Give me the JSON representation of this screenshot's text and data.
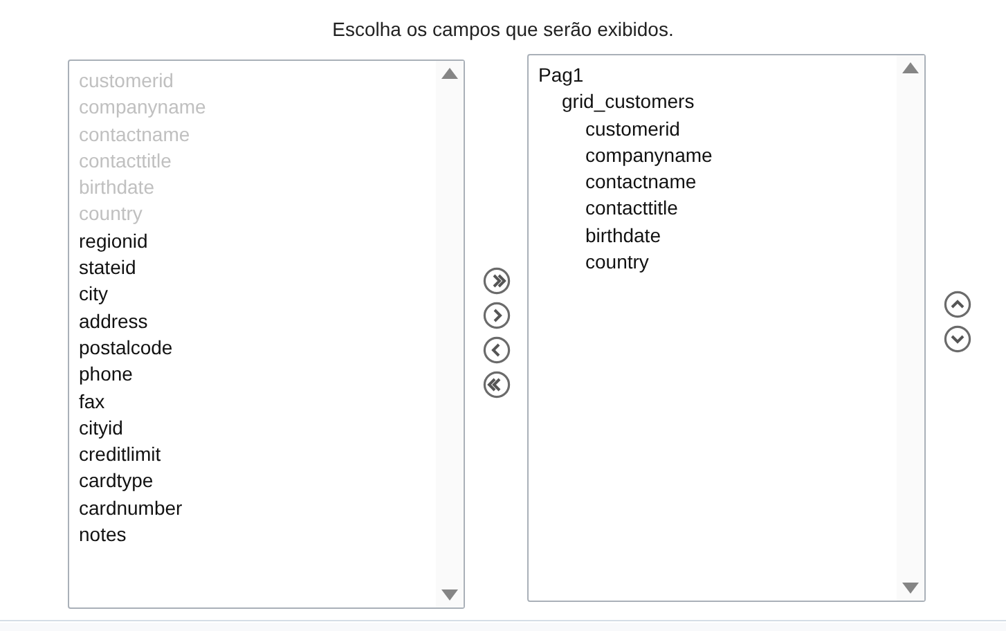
{
  "heading": "Escolha os campos que serão exibidos.",
  "available_fields": [
    {
      "label": "customerid",
      "disabled": true
    },
    {
      "label": "companyname",
      "disabled": true
    },
    {
      "label": "contactname",
      "disabled": true
    },
    {
      "label": "contacttitle",
      "disabled": true
    },
    {
      "label": "birthdate",
      "disabled": true
    },
    {
      "label": "country",
      "disabled": true
    },
    {
      "label": "regionid",
      "disabled": false
    },
    {
      "label": "stateid",
      "disabled": false
    },
    {
      "label": "city",
      "disabled": false
    },
    {
      "label": "address",
      "disabled": false
    },
    {
      "label": "postalcode",
      "disabled": false
    },
    {
      "label": "phone",
      "disabled": false
    },
    {
      "label": "fax",
      "disabled": false
    },
    {
      "label": "cityid",
      "disabled": false
    },
    {
      "label": "creditlimit",
      "disabled": false
    },
    {
      "label": "cardtype",
      "disabled": false
    },
    {
      "label": "cardnumber",
      "disabled": false
    },
    {
      "label": "notes",
      "disabled": false
    }
  ],
  "transfer_buttons": [
    {
      "kind": "add_all"
    },
    {
      "kind": "add"
    },
    {
      "kind": "remove"
    },
    {
      "kind": "remove_all"
    }
  ],
  "selected_fields": [
    {
      "label": "Pag1",
      "children": [
        {
          "label": "grid_customers",
          "children": [
            {
              "label": "customerid"
            },
            {
              "label": "companyname"
            },
            {
              "label": "contactname"
            },
            {
              "label": "contacttitle"
            },
            {
              "label": "birthdate"
            },
            {
              "label": "country"
            }
          ]
        }
      ]
    }
  ],
  "order_buttons": [
    {
      "kind": "up"
    },
    {
      "kind": "down"
    }
  ]
}
